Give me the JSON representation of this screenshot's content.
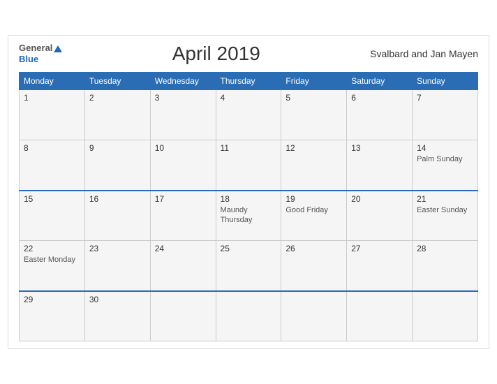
{
  "header": {
    "logo_general": "General",
    "logo_blue": "Blue",
    "title": "April 2019",
    "region": "Svalbard and Jan Mayen"
  },
  "weekdays": [
    "Monday",
    "Tuesday",
    "Wednesday",
    "Thursday",
    "Friday",
    "Saturday",
    "Sunday"
  ],
  "weeks": [
    [
      {
        "day": "1",
        "event": ""
      },
      {
        "day": "2",
        "event": ""
      },
      {
        "day": "3",
        "event": ""
      },
      {
        "day": "4",
        "event": ""
      },
      {
        "day": "5",
        "event": ""
      },
      {
        "day": "6",
        "event": ""
      },
      {
        "day": "7",
        "event": ""
      }
    ],
    [
      {
        "day": "8",
        "event": ""
      },
      {
        "day": "9",
        "event": ""
      },
      {
        "day": "10",
        "event": ""
      },
      {
        "day": "11",
        "event": ""
      },
      {
        "day": "12",
        "event": ""
      },
      {
        "day": "13",
        "event": ""
      },
      {
        "day": "14",
        "event": "Palm Sunday"
      }
    ],
    [
      {
        "day": "15",
        "event": ""
      },
      {
        "day": "16",
        "event": ""
      },
      {
        "day": "17",
        "event": ""
      },
      {
        "day": "18",
        "event": "Maundy Thursday"
      },
      {
        "day": "19",
        "event": "Good Friday"
      },
      {
        "day": "20",
        "event": ""
      },
      {
        "day": "21",
        "event": "Easter Sunday"
      }
    ],
    [
      {
        "day": "22",
        "event": "Easter Monday"
      },
      {
        "day": "23",
        "event": ""
      },
      {
        "day": "24",
        "event": ""
      },
      {
        "day": "25",
        "event": ""
      },
      {
        "day": "26",
        "event": ""
      },
      {
        "day": "27",
        "event": ""
      },
      {
        "day": "28",
        "event": ""
      }
    ],
    [
      {
        "day": "29",
        "event": ""
      },
      {
        "day": "30",
        "event": ""
      },
      {
        "day": "",
        "event": ""
      },
      {
        "day": "",
        "event": ""
      },
      {
        "day": "",
        "event": ""
      },
      {
        "day": "",
        "event": ""
      },
      {
        "day": "",
        "event": ""
      }
    ]
  ]
}
